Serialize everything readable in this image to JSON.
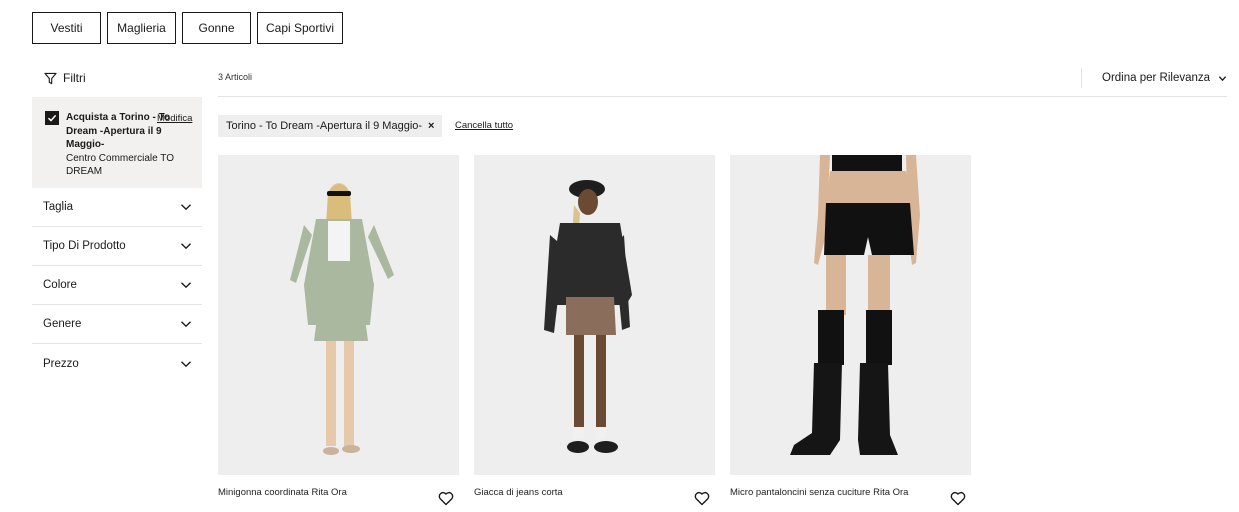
{
  "categories": [
    {
      "label": "Vestiti"
    },
    {
      "label": "Maglieria"
    },
    {
      "label": "Gonne"
    },
    {
      "label": "Capi Sportivi"
    }
  ],
  "sidebar": {
    "filter_label": "Filtri",
    "store": {
      "checked": true,
      "name": "Acquista a Torino - To Dream -Apertura il 9 Maggio-",
      "edit_label": "Modifica",
      "subtitle": "Centro Commerciale TO DREAM"
    },
    "facets": [
      {
        "label": "Taglia"
      },
      {
        "label": "Tipo Di Prodotto"
      },
      {
        "label": "Colore"
      },
      {
        "label": "Genere"
      },
      {
        "label": "Prezzo"
      }
    ]
  },
  "toolbar": {
    "count": "3 Articoli",
    "sort_label": "Ordina per Rilevanza"
  },
  "active_filters": {
    "chip_label": "Torino - To Dream -Apertura il 9 Maggio-",
    "chip_remove": "×",
    "clear_all": "Cancella tutto"
  },
  "products": [
    {
      "title": "Minigonna coordinata Rita Ora",
      "top_color": "#a9b89f",
      "bottom_color": "#a9b89f",
      "shoe_color": "#c9b39a"
    },
    {
      "title": "Giacca di jeans corta",
      "top_color": "#2b2b2b",
      "bottom_color": "#8a6d5a",
      "shoe_color": "#1e1e1e"
    },
    {
      "title": "Micro pantaloncini senza cuciture Rita Ora",
      "top_color": "#111111",
      "bottom_color": "#111111",
      "shoe_color": "#151515"
    }
  ],
  "colors": {
    "accent": "#1a1a1a",
    "panel_bg": "#f2f1ef",
    "image_bg": "#eeeeee"
  },
  "icons": {
    "filter": "filter-funnel-icon",
    "check": "check-icon",
    "chevron": "chevron-down-icon",
    "heart": "heart-outline-icon",
    "close": "close-icon"
  }
}
